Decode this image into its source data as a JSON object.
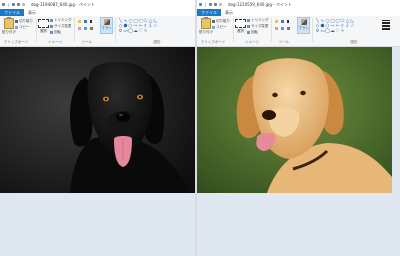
{
  "colors": {
    "file_tab": "#1979ca",
    "ribbon_bg": "#f5f6f7",
    "workspace_bg": "#dfe7f1"
  },
  "windows": [
    {
      "title": "dog-1194087_640.jpg - ペイント",
      "tabs": {
        "file": "ファイル",
        "view": "表示"
      },
      "ribbon": {
        "clipboard": {
          "paste": "貼り付け",
          "cut": "切り取り",
          "copy": "コピー",
          "label": "クリップボード"
        },
        "image": {
          "select": "選択",
          "crop": "トリミング",
          "resize": "サイズ変更",
          "rotate": "回転",
          "label": "イメージ"
        },
        "tools": {
          "label": "ツール"
        },
        "brush": {
          "label": "ブラシ"
        },
        "shapes": {
          "label": "図形"
        }
      },
      "photo": {
        "subject": "black dog on dark background"
      }
    },
    {
      "title": "dog-1210559_640.jpg - ペイント",
      "tabs": {
        "file": "ファイル",
        "view": "表示"
      },
      "ribbon": {
        "clipboard": {
          "paste": "貼り付け",
          "cut": "切り取り",
          "copy": "コピー",
          "label": "クリップボード"
        },
        "image": {
          "select": "選択",
          "crop": "トリミング",
          "resize": "サイズ変更",
          "rotate": "回転",
          "label": "イメージ"
        },
        "tools": {
          "label": "ツール"
        },
        "brush": {
          "label": "ブラシ"
        },
        "shapes": {
          "label": "図形"
        }
      },
      "photo": {
        "subject": "golden labrador on green background"
      }
    }
  ]
}
